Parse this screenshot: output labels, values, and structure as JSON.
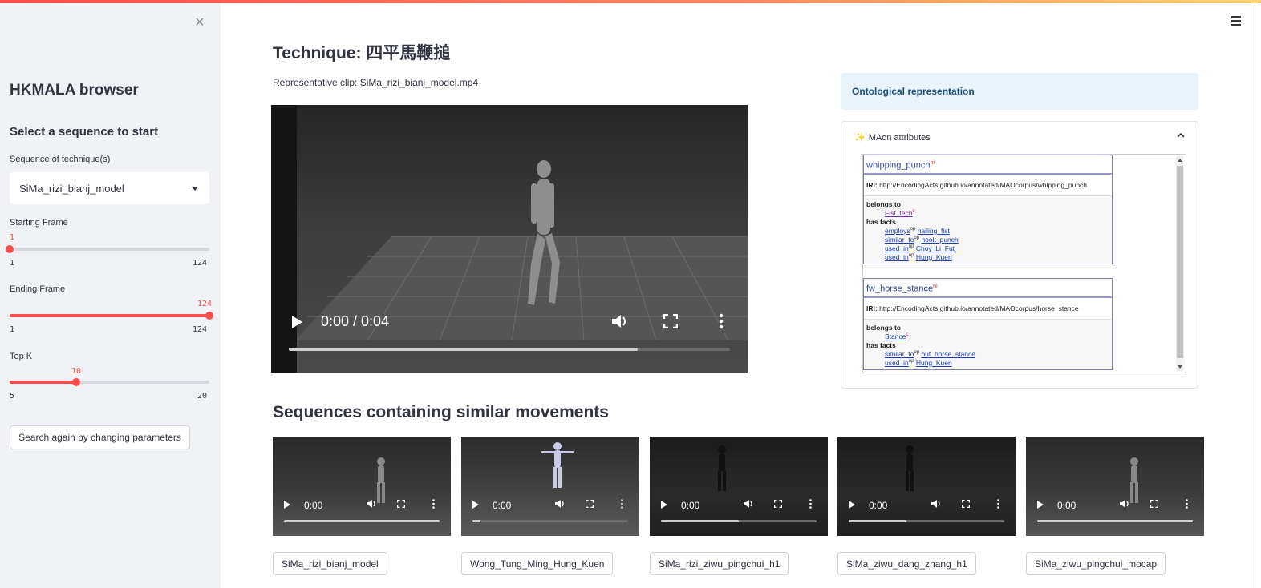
{
  "sidebar": {
    "close_glyph": "×",
    "title": "HKMALA browser",
    "subtitle": "Select a sequence to start",
    "sequence_label": "Sequence of technique(s)",
    "sequence_value": "SiMa_rizi_bianj_model",
    "start_label": "Starting Frame",
    "start_value": "1",
    "start_min": "1",
    "start_max": "124",
    "end_label": "Ending Frame",
    "end_value": "124",
    "end_min": "1",
    "end_max": "124",
    "topk_label": "Top K",
    "topk_value": "10",
    "topk_min": "5",
    "topk_max": "20",
    "search_button": "Search again by changing parameters",
    "accent_color": "#ff4b4b"
  },
  "main": {
    "title": "Technique: 四平馬鞭搥",
    "clip_caption": "Representative clip: SiMa_rizi_bianj_model.mp4",
    "video": {
      "time": "0:00 / 0:04",
      "progress": 0.0
    },
    "ontology_header": "Ontological representation",
    "expander_title": "MAon attributes",
    "expander_icon": "sparkles-icon",
    "owl": [
      {
        "name": "whipping_punch",
        "name_sup": "ni",
        "iri_label": "IRI:",
        "iri": "http://EncodingActs.github.io/annotated/MAOcorpus/whipping_punch",
        "belongs_label": "belongs to",
        "belongs": "Fist_tech",
        "facts_label": "has facts",
        "facts": [
          {
            "prop": "employs",
            "sup": "op",
            "val": "nailing_fist"
          },
          {
            "prop": "similar_to",
            "sup": "op",
            "val": "hook_punch"
          },
          {
            "prop": "used_in",
            "sup": "op",
            "val": "Choy_Li_Fut"
          },
          {
            "prop": "used_in",
            "sup": "op",
            "val": "Hung_Kuen"
          }
        ]
      },
      {
        "name": "fw_horse_stance",
        "name_sup": "ni",
        "iri_label": "IRI:",
        "iri": "http://EncodingActs.github.io/annotated/MAOcorpus/horse_stance",
        "belongs_label": "belongs to",
        "belongs": "Stance",
        "facts_label": "has facts",
        "facts": [
          {
            "prop": "similar_to",
            "sup": "op",
            "val": "out_horse_stance"
          },
          {
            "prop": "used_in",
            "sup": "op",
            "val": "Hung_Kuen"
          }
        ]
      }
    ],
    "similar_title": "Sequences containing similar movements",
    "similar": [
      {
        "time": "0:00",
        "label": "SiMa_rizi_bianj_model",
        "progress": 1.0
      },
      {
        "time": "0:00",
        "label": "Wong_Tung_Ming_Hung_Kuen",
        "progress": 0.05
      },
      {
        "time": "0:00",
        "label": "SiMa_rizi_ziwu_pingchui_h1",
        "progress": 0.5
      },
      {
        "time": "0:00",
        "label": "SiMa_ziwu_dang_zhang_h1",
        "progress": 0.37
      },
      {
        "time": "0:00",
        "label": "SiMa_ziwu_pingchui_mocap",
        "progress": 1.0
      }
    ]
  }
}
